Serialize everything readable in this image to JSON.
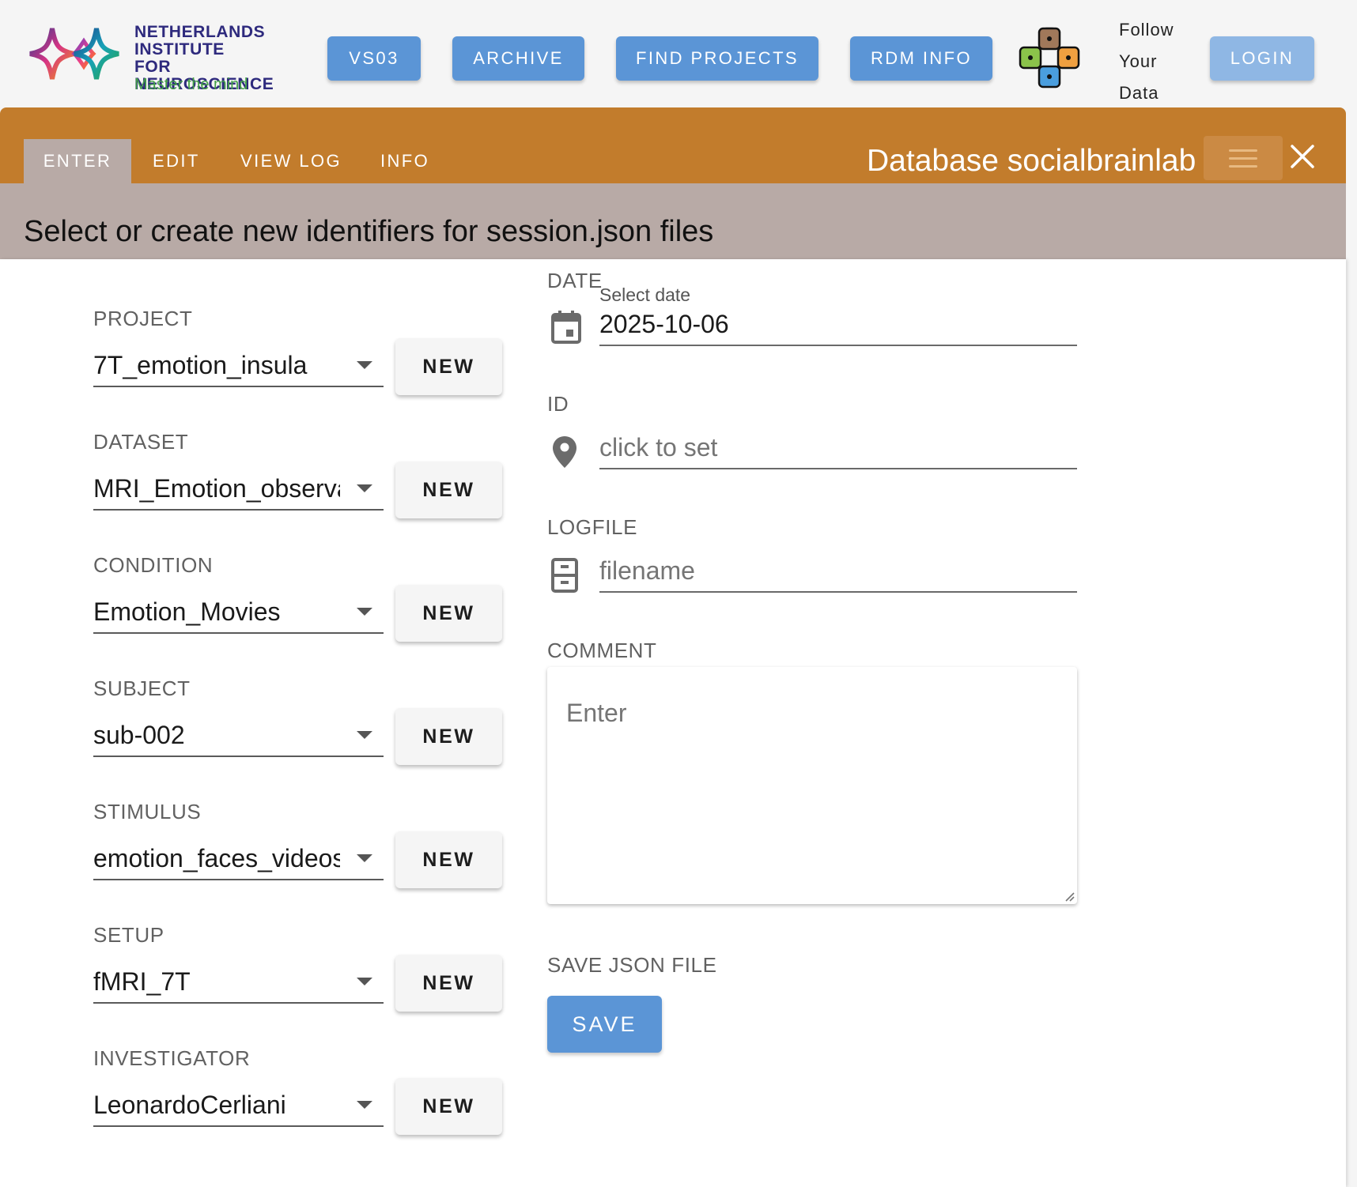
{
  "header": {
    "logo": {
      "line1": "NETHERLANDS",
      "line2": "INSTITUTE",
      "line3": "FOR NEUROSCIENCE",
      "tagline": "Master the mind"
    },
    "nav": {
      "vs03": "VS03",
      "archive": "ARCHIVE",
      "find_projects": "FIND PROJECTS",
      "rdm_info": "RDM INFO"
    },
    "follow": [
      "Follow",
      "Your",
      "Data"
    ],
    "login": "LOGIN"
  },
  "tabs": {
    "enter": "ENTER",
    "edit": "EDIT",
    "view_log": "VIEW LOG",
    "info": "INFO",
    "active": "ENTER"
  },
  "database_title": "Database socialbrainlab",
  "section_title": "Select or create new identifiers for session.json files",
  "fields": {
    "new_label": "NEW",
    "project": {
      "label": "PROJECT",
      "value": "7T_emotion_insula"
    },
    "dataset": {
      "label": "DATASET",
      "value": "MRI_Emotion_observation"
    },
    "condition": {
      "label": "CONDITION",
      "value": "Emotion_Movies"
    },
    "subject": {
      "label": "SUBJECT",
      "value": "sub-002"
    },
    "stimulus": {
      "label": "STIMULUS",
      "value": "emotion_faces_videos"
    },
    "setup": {
      "label": "SETUP",
      "value": "fMRI_7T"
    },
    "investigator": {
      "label": "INVESTIGATOR",
      "value": "LeonardoCerliani"
    }
  },
  "right": {
    "date": {
      "label": "DATE",
      "small_label": "Select date",
      "value": "2025-10-06"
    },
    "id": {
      "label": "ID",
      "placeholder": "click to set"
    },
    "logfile": {
      "label": "LOGFILE",
      "placeholder": "filename"
    },
    "comment": {
      "label": "COMMENT",
      "placeholder": "Enter"
    },
    "save_section": {
      "label": "SAVE JSON FILE",
      "button": "SAVE"
    }
  },
  "colors": {
    "primary_button": "#5b95d6",
    "login_button": "#8fb7e4",
    "tab_bar": "#c27c2c",
    "section_header": "#b8aaa6"
  },
  "icons": [
    "calendar-icon",
    "map-pin-icon",
    "file-cabinet-icon",
    "menu-icon",
    "close-icon",
    "dropdown-arrow-icon"
  ]
}
